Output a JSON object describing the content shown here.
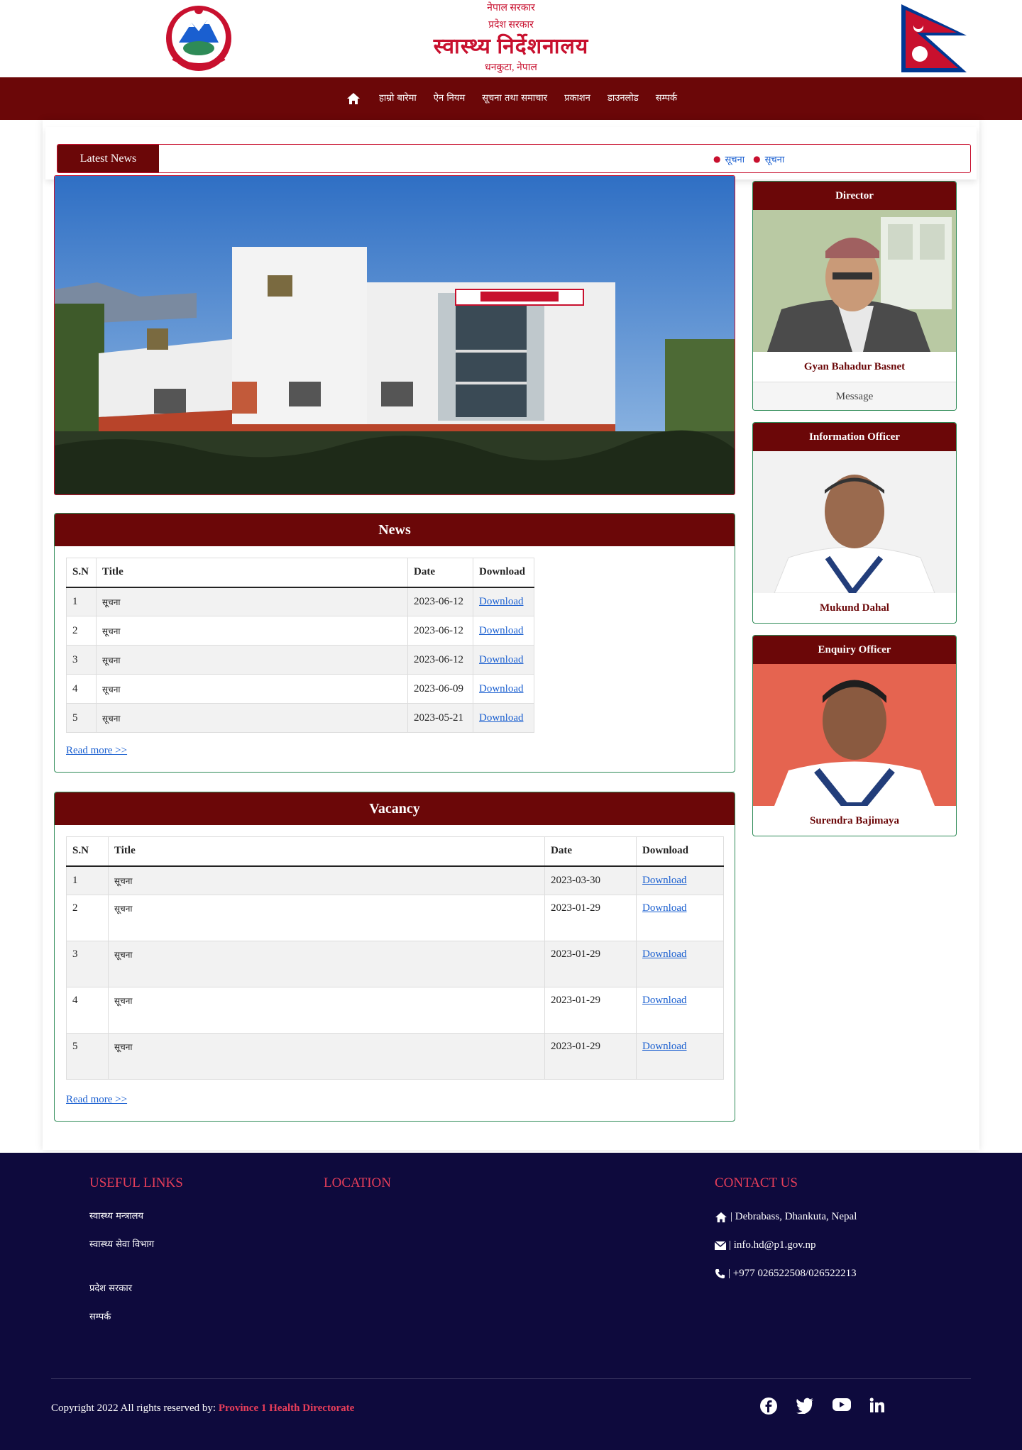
{
  "header": {
    "line1": "नेपाल सरकार",
    "line2": "प्रदेश सरकार",
    "title": "स्वास्थ्य निर्देशनालय",
    "address": "धनकुटा, नेपाल"
  },
  "nav": {
    "items": [
      {
        "label": "हाम्रो बारेमा"
      },
      {
        "label": "ऐन नियम"
      },
      {
        "label": "सूचना तथा समाचार"
      },
      {
        "label": "प्रकाशन"
      },
      {
        "label": "डाउनलोड"
      },
      {
        "label": "सम्पर्क"
      }
    ]
  },
  "ticker": {
    "label": "Latest News",
    "items": [
      "सूचना",
      "सूचना"
    ]
  },
  "news": {
    "heading": "News",
    "columns": [
      "S.N",
      "Title",
      "Date",
      "Download"
    ],
    "rows": [
      {
        "sn": "1",
        "title": "सूचना",
        "date": "2023-06-12",
        "download": "Download"
      },
      {
        "sn": "2",
        "title": "सूचना",
        "date": "2023-06-12",
        "download": "Download"
      },
      {
        "sn": "3",
        "title": "सूचना",
        "date": "2023-06-12",
        "download": "Download"
      },
      {
        "sn": "4",
        "title": "सूचना",
        "date": "2023-06-09",
        "download": "Download"
      },
      {
        "sn": "5",
        "title": "सूचना",
        "date": "2023-05-21",
        "download": "Download"
      }
    ],
    "read_more": "Read more >>"
  },
  "vacancy": {
    "heading": "Vacancy",
    "columns": [
      "S.N",
      "Title",
      "Date",
      "Download"
    ],
    "rows": [
      {
        "sn": "1",
        "title": "सूचना",
        "date": "2023-03-30",
        "download": "Download"
      },
      {
        "sn": "2",
        "title": "सूचना",
        "date": "2023-01-29",
        "download": "Download"
      },
      {
        "sn": "3",
        "title": "सूचना",
        "date": "2023-01-29",
        "download": "Download"
      },
      {
        "sn": "4",
        "title": "सूचना",
        "date": "2023-01-29",
        "download": "Download"
      },
      {
        "sn": "5",
        "title": "सूचना",
        "date": "2023-01-29",
        "download": "Download"
      }
    ],
    "read_more": "Read more >>"
  },
  "sidebar": {
    "director": {
      "heading": "Director",
      "name": "Gyan Bahadur Basnet",
      "message": "Message"
    },
    "info_officer": {
      "heading": "Information Officer",
      "name": "Mukund Dahal"
    },
    "enquiry_officer": {
      "heading": "Enquiry Officer",
      "name": "Surendra Bajimaya"
    }
  },
  "footer": {
    "useful_links_title": "USEFUL LINKS",
    "links": [
      "स्वास्थ्य मन्त्रालय",
      "स्वास्थ्य सेवा विभाग",
      "प्रदेश सरकार",
      "सम्पर्क"
    ],
    "location_title": "LOCATION",
    "contact_title": "CONTACT US",
    "address": "| Debrabass, Dhankuta, Nepal",
    "email": "| info.hd@p1.gov.np",
    "phone": "| +977 026522508/026522213",
    "copyright_prefix": "Copyright 2022 All rights reserved by:",
    "copyright_org": "Province 1 Health Directorate"
  },
  "colors": {
    "maroon": "#6b0708",
    "red": "#c8102e",
    "green_border": "#2e8b57",
    "footer_bg": "#0e0a3d",
    "link_blue": "#1a5fd0"
  }
}
